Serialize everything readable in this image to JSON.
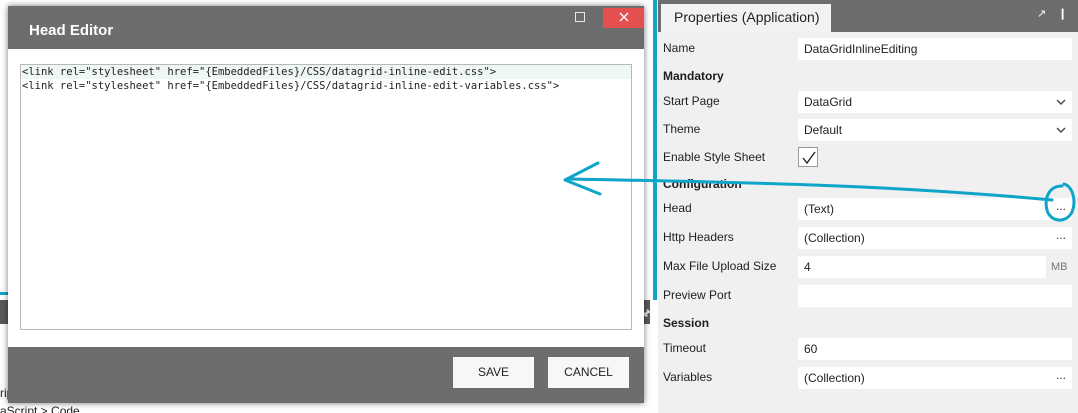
{
  "background": {
    "text1": "rip",
    "text2": "aScript > Code"
  },
  "dialog": {
    "title": "Head Editor",
    "maximize_icon": "maximize-icon",
    "close_icon": "close-icon",
    "lines": [
      "<link rel=\"stylesheet\" href=\"{EmbeddedFiles}/CSS/datagrid-inline-edit.css\">",
      "<link rel=\"stylesheet\" href=\"{EmbeddedFiles}/CSS/datagrid-inline-edit-variables.css\">"
    ],
    "save_label": "SAVE",
    "cancel_label": "CANCEL"
  },
  "properties": {
    "tab_label": "Properties (Application)",
    "name_label": "Name",
    "name_value": "DataGridInlineEditing",
    "mandatory_section": "Mandatory",
    "start_page_label": "Start Page",
    "start_page_value": "DataGrid",
    "theme_label": "Theme",
    "theme_value": "Default",
    "enable_style_label": "Enable Style Sheet",
    "enable_style_checked": true,
    "configuration_section": "Configuration",
    "head_label": "Head",
    "head_value": "(Text)",
    "http_headers_label": "Http Headers",
    "http_headers_value": "(Collection)",
    "max_upload_label": "Max File Upload Size",
    "max_upload_value": "4",
    "max_upload_unit": "MB",
    "preview_port_label": "Preview Port",
    "preview_port_value": "",
    "session_section": "Session",
    "timeout_label": "Timeout",
    "timeout_value": "60",
    "variables_label": "Variables",
    "variables_value": "(Collection)",
    "ellipsis": "..."
  },
  "colors": {
    "annotation": "#0fa5c9",
    "dialog_chrome": "#6d6d6d",
    "close_button": "#e45050"
  }
}
